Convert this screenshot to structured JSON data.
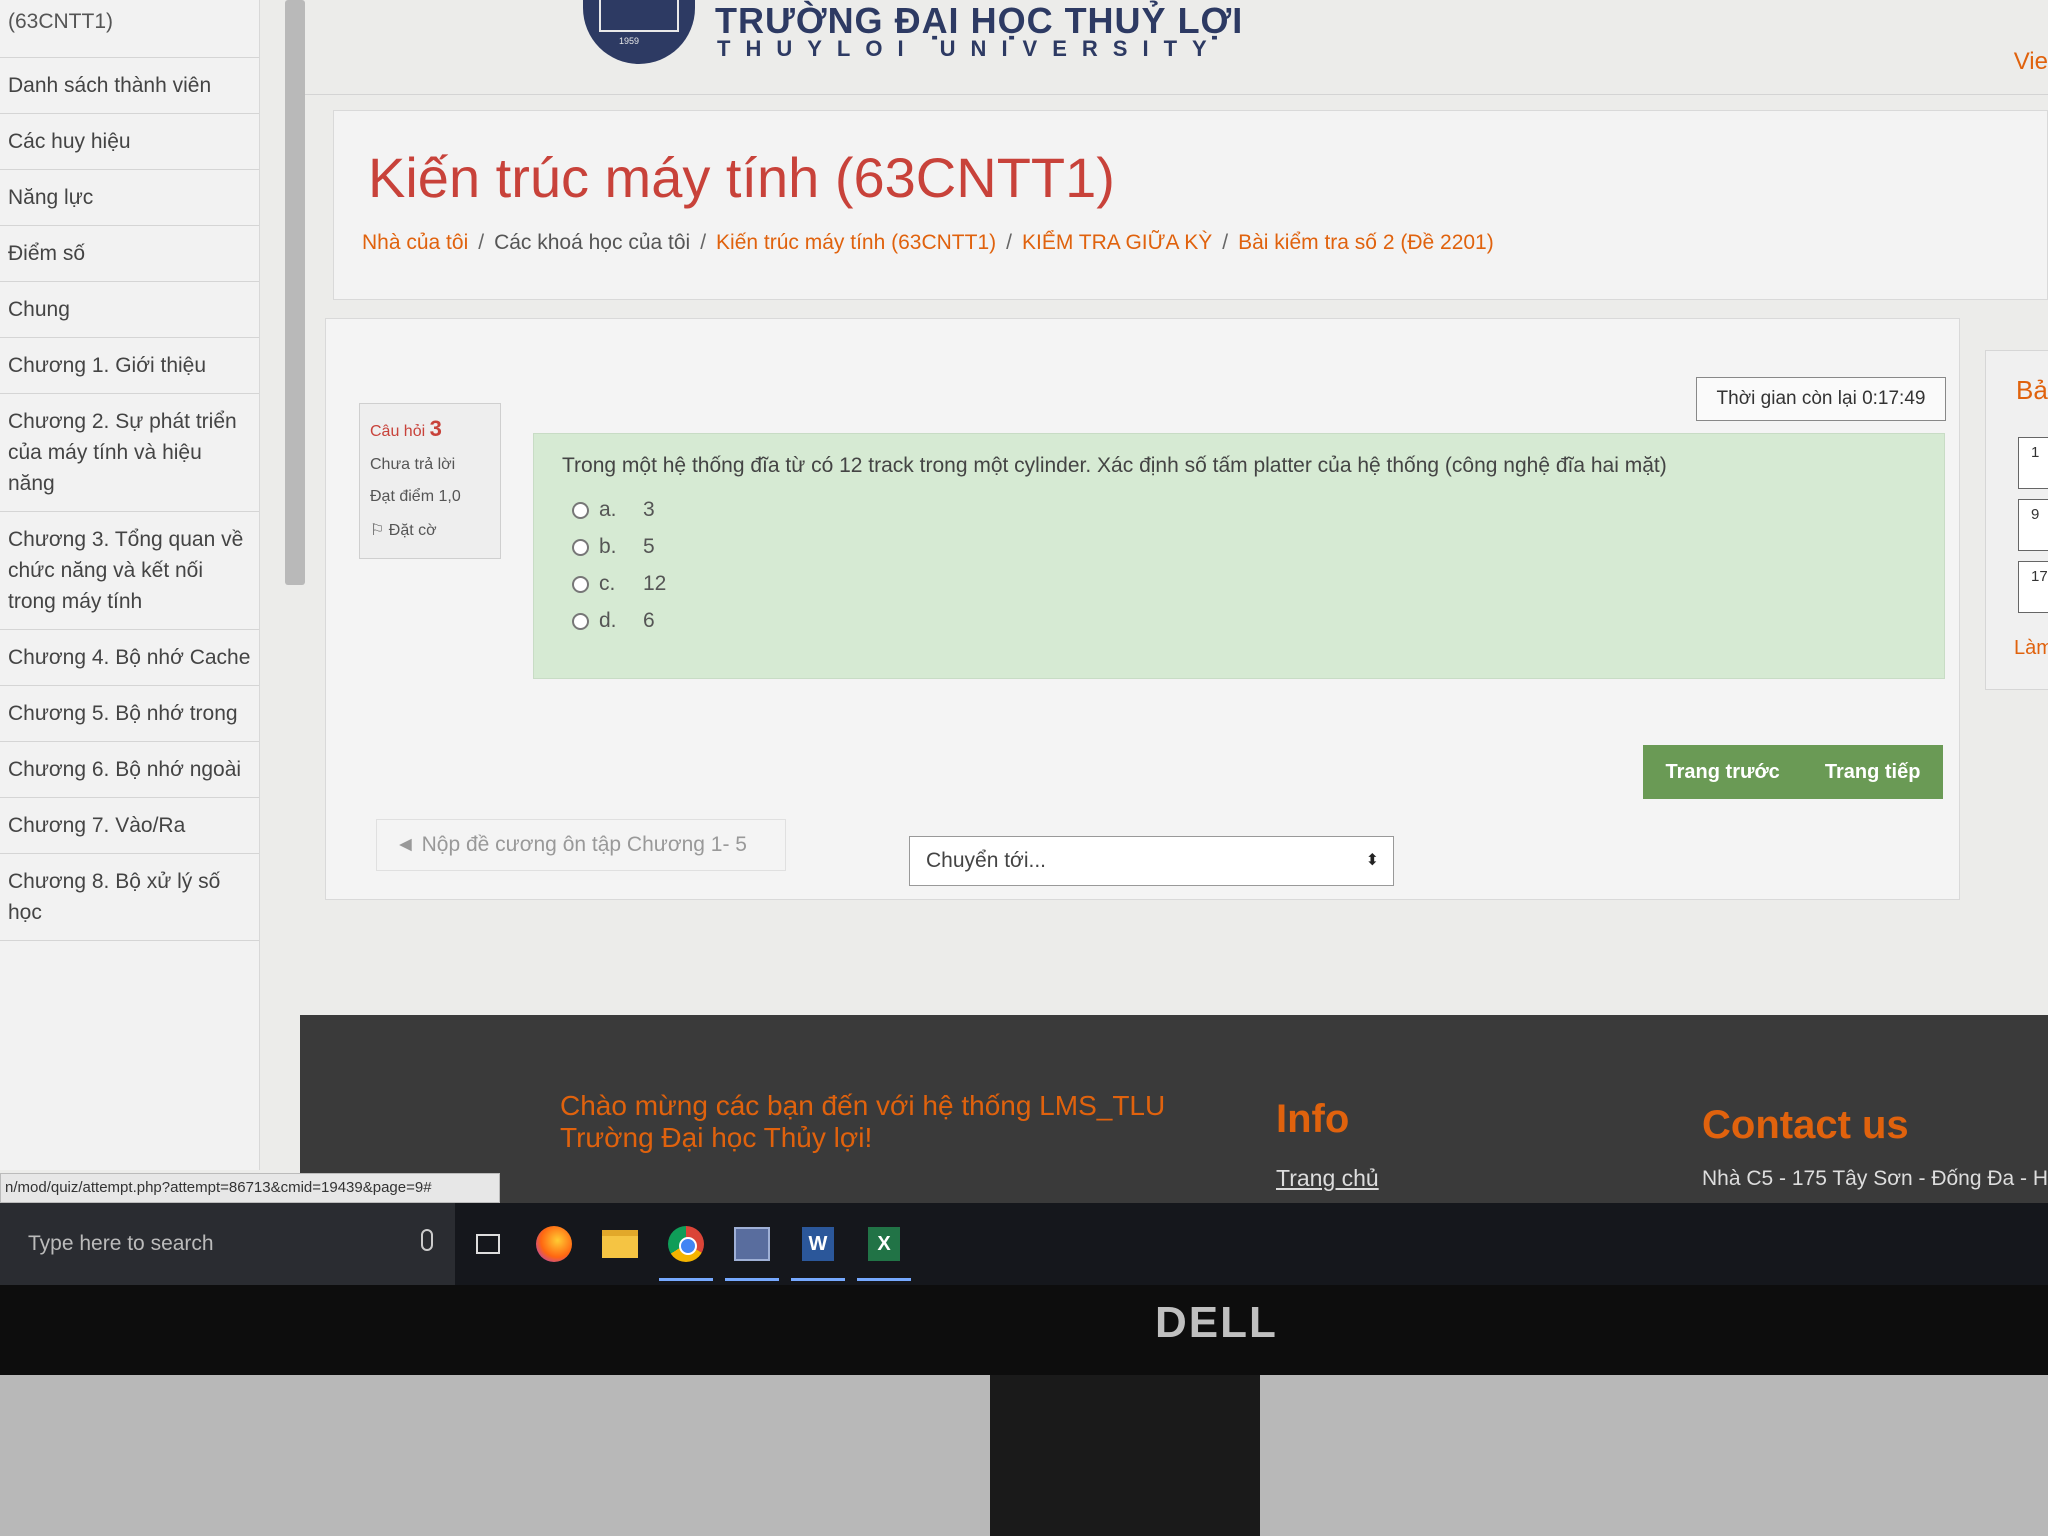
{
  "sidebar": {
    "items": [
      "(63CNTT1)",
      "Danh sách thành viên",
      "Các huy hiệu",
      "Năng lực",
      "Điểm số",
      "Chung",
      "Chương 1. Giới thiệu",
      "Chương 2. Sự phát triển của máy tính và hiệu năng",
      "Chương 3. Tổng quan về chức năng và kết nối trong máy tính",
      "Chương 4. Bộ nhớ Cache",
      "Chương 5. Bộ nhớ trong",
      "Chương 6. Bộ nhớ ngoài",
      "Chương 7. Vào/Ra",
      "Chương 8. Bộ xử lý số học"
    ]
  },
  "header": {
    "title": "TRƯỜNG ĐẠI HỌC THUỶ LỢI",
    "subtitle": "THUYLOI UNIVERSITY",
    "logo_year": "1959",
    "lang": "Vie"
  },
  "course": {
    "title": "Kiến trúc máy tính (63CNTT1)",
    "breadcrumb": [
      "Nhà của tôi",
      "Các khoá học của tôi",
      "Kiến trúc máy tính (63CNTT1)",
      "KIỂM TRA GIỮA KỲ",
      "Bài kiểm tra số 2 (Đề 2201)"
    ],
    "separator": "/"
  },
  "quiz": {
    "question_label": "Câu hỏi",
    "question_number": "3",
    "status": "Chưa trả lời",
    "points": "Đạt điểm 1,0",
    "flag_label": "Đặt cờ",
    "timer": "Thời gian còn lại 0:17:49",
    "question_text": "Trong một hệ thống đĩa từ có 12 track trong một cylinder. Xác định số tấm platter của hệ thống (công nghệ đĩa hai mặt)",
    "answers": [
      {
        "letter": "a.",
        "value": "3"
      },
      {
        "letter": "b.",
        "value": "5"
      },
      {
        "letter": "c.",
        "value": "12"
      },
      {
        "letter": "d.",
        "value": "6"
      }
    ],
    "prev_button": "Trang trước",
    "next_button": "Trang tiếp",
    "prev_activity": "◄ Nộp đề cương ôn tập Chương 1- 5",
    "jump_select": "Chuyển tới...",
    "jump_arrows": "⬍"
  },
  "nav_panel": {
    "title": "Bả",
    "boxes": [
      "1",
      "9",
      "17"
    ],
    "finish": "Làm"
  },
  "footer": {
    "welcome": "Chào mừng các bạn đến với hệ thống LMS_TLU Trường Đại học Thủy lợi!",
    "info_heading": "Info",
    "home_link": "Trang chủ",
    "contact_heading": "Contact us",
    "address": "Nhà C5 - 175 Tây Sơn - Đống Đa - Hà"
  },
  "status_url": "n/mod/quiz/attempt.php?attempt=86713&cmid=19439&page=9#",
  "taskbar": {
    "search_placeholder": "Type here to search",
    "icons": [
      "task-view-icon",
      "firefox-icon",
      "file-explorer-icon",
      "chrome-icon",
      "app-icon",
      "word-icon",
      "excel-icon"
    ],
    "word_letter": "W",
    "excel_letter": "X"
  },
  "monitor": {
    "brand": "DELL"
  },
  "colors": {
    "accent": "#e0620d",
    "title_red": "#c8423a",
    "question_bg": "#d6ead3",
    "button_green": "#6a9a55",
    "footer_bg": "#3a3a3a"
  }
}
